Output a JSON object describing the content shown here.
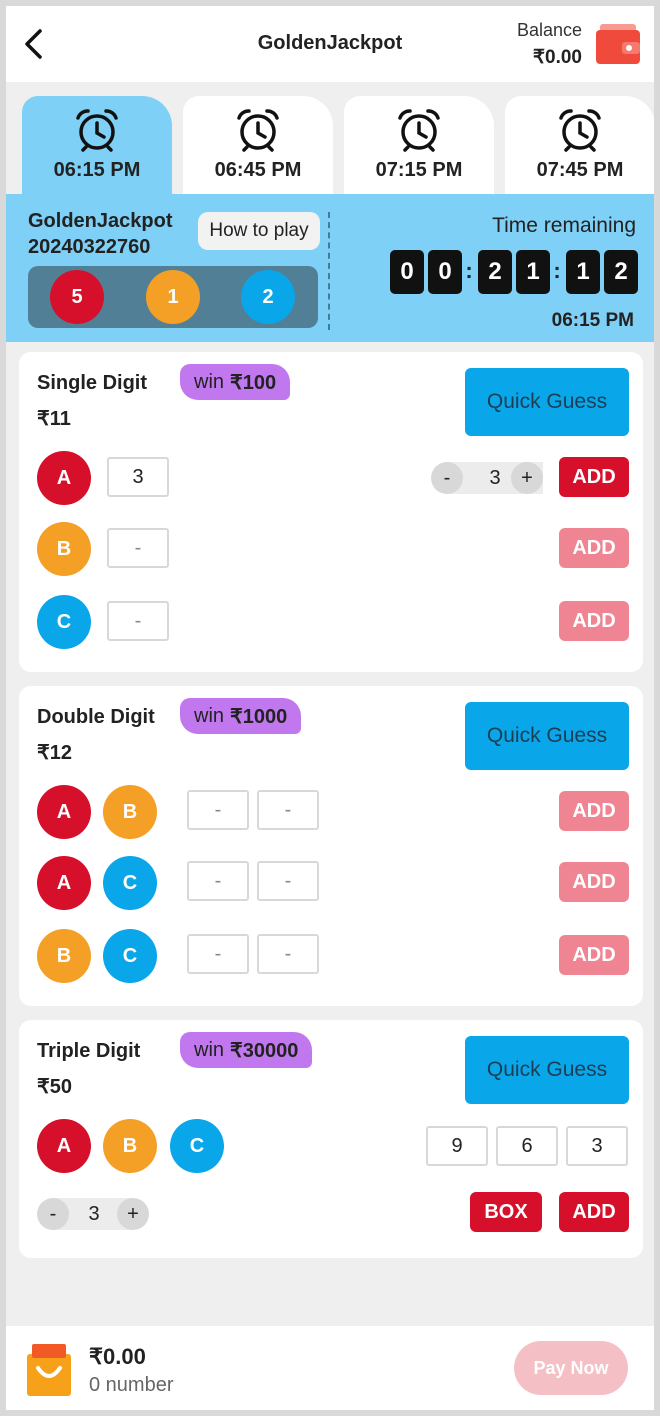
{
  "header": {
    "title": "GoldenJackpot",
    "balance_label": "Balance",
    "balance_value": "₹0.00"
  },
  "tabs": [
    {
      "label": "06:15 PM",
      "active": true
    },
    {
      "label": "06:45 PM",
      "active": false
    },
    {
      "label": "07:15 PM",
      "active": false
    },
    {
      "label": "07:45 PM",
      "active": false
    }
  ],
  "banner": {
    "game_name": "GoldenJackpot",
    "issue": "20240322760",
    "how_to_play": "How to play",
    "last_result": [
      "5",
      "1",
      "2"
    ],
    "time_remaining_label": "Time remaining",
    "timer_digits": [
      "0",
      "0",
      "2",
      "1",
      "1",
      "2"
    ],
    "colon": ":",
    "draw_time": "06:15 PM"
  },
  "single": {
    "title": "Single Digit",
    "price": "₹11",
    "win_label": "win",
    "win_amount": "₹100",
    "quick_guess": "Quick Guess",
    "rows": [
      {
        "ball": "A",
        "value": "3",
        "placeholder": "-",
        "add": "ADD"
      },
      {
        "ball": "B",
        "value": "",
        "placeholder": "-",
        "add": "ADD"
      },
      {
        "ball": "C",
        "value": "",
        "placeholder": "-",
        "add": "ADD"
      }
    ],
    "stepper": {
      "minus": "-",
      "value": "3",
      "plus": "+"
    }
  },
  "double": {
    "title": "Double Digit",
    "price": "₹12",
    "win_label": "win",
    "win_amount": "₹1000",
    "quick_guess": "Quick Guess",
    "rows": [
      {
        "balls": [
          "A",
          "B"
        ],
        "placeholder": "-",
        "add": "ADD"
      },
      {
        "balls": [
          "A",
          "C"
        ],
        "placeholder": "-",
        "add": "ADD"
      },
      {
        "balls": [
          "B",
          "C"
        ],
        "placeholder": "-",
        "add": "ADD"
      }
    ]
  },
  "triple": {
    "title": "Triple Digit",
    "price": "₹50",
    "win_label": "win",
    "win_amount": "₹30000",
    "quick_guess": "Quick Guess",
    "balls": [
      "A",
      "B",
      "C"
    ],
    "values": [
      "9",
      "6",
      "3"
    ],
    "stepper": {
      "minus": "-",
      "value": "3",
      "plus": "+"
    },
    "box": "BOX",
    "add": "ADD"
  },
  "footer": {
    "amount": "₹0.00",
    "count": "0 number",
    "pay_now": "Pay Now"
  },
  "colors": {
    "accent_blue": "#0aa6ea",
    "banner_blue": "#7fd0f6",
    "red": "#d6102a",
    "orange": "#f4a027",
    "purple": "#c178ee",
    "wallet": "#ef4a3c"
  }
}
